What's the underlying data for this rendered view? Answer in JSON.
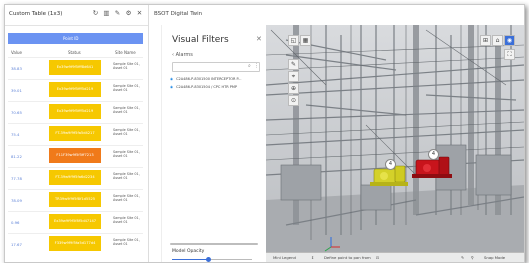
{
  "table": {
    "title": "Custom Table (1x3)",
    "icons": [
      "refresh-icon",
      "bar-chart-icon",
      "edit-icon",
      "settings-icon",
      "close-icon"
    ],
    "icon_glyphs": [
      "↻",
      "▥",
      "✎",
      "⚙",
      "✕"
    ],
    "header_band": "Point ID",
    "columns": [
      "Value",
      "Status",
      "Site Name"
    ],
    "rows": [
      {
        "value": "38.83",
        "status": "Ex39w9f9f5fff8d641",
        "site": "Sample Site 01, Asset 01",
        "color": "#f6c800"
      },
      {
        "value": "39.01",
        "status": "Ex39w9f9f5fff5d219",
        "site": "Sample Site 01, Asset 01",
        "color": "#f6c800"
      },
      {
        "value": "70.65",
        "status": "Ex39w9f9f5fff5d219",
        "site": "Sample Site 01, Asset 01",
        "color": "#f6c800"
      },
      {
        "value": "75.4",
        "status": "FT-39w9f9f5fa5d4217",
        "site": "Sample Site 01, Asset 01",
        "color": "#f6c800"
      },
      {
        "value": "81.22",
        "status": "F11F39w9f5f5ff7213",
        "site": "Sample Site 01, Asset 01",
        "color": "#f07a1a"
      },
      {
        "value": "77.78",
        "status": "FT-39w9f9f5fa6d2234",
        "site": "Sample Site 01, Asset 01",
        "color": "#f6c800"
      },
      {
        "value": "78.09",
        "status": "TR39w9f9f5f8f1d5525",
        "site": "Sample Site 01, Asset 01",
        "color": "#f6c800"
      },
      {
        "value": "0.96",
        "status": "Ex39w9f9f5f8f5d47147",
        "site": "Sample Site 01, Asset 01",
        "color": "#f6c800"
      },
      {
        "value": "17.67",
        "status": "F339w9f9f5fa5d177d4",
        "site": "Sample Site 01, Asset 01",
        "color": "#f6c800"
      }
    ]
  },
  "filters": {
    "panel_title": "BSOT Digital Twin",
    "heading": "Visual Filters",
    "back_label": "Alarms",
    "search_placeholder": "",
    "items": [
      "C2A486-P-8301500 INTERCEPTOR P...",
      "C2A486-P-8301504 / CPC HTR PMP"
    ],
    "opacity_label": "Model Opacity",
    "opacity_value": 0.45
  },
  "viewport": {
    "left_tools": [
      "◱",
      "▦"
    ],
    "side_tools": [
      "✎",
      "⌖",
      "⊕",
      "⊙"
    ],
    "right_tools": [
      "⊞",
      "⌂",
      "◉",
      "⛶"
    ],
    "pin_labels": [
      "4",
      "4"
    ],
    "bottom_left": "Mini Legend",
    "bottom_mid": "Define point to pan from",
    "bottom_right": "Snap Mode"
  },
  "colors": {
    "accent_blue": "#6b93f2",
    "warning_yellow": "#f6c800",
    "alarm_orange": "#f07a1a",
    "pump_yellow": "#d4d12a",
    "pump_red": "#c8141c"
  }
}
